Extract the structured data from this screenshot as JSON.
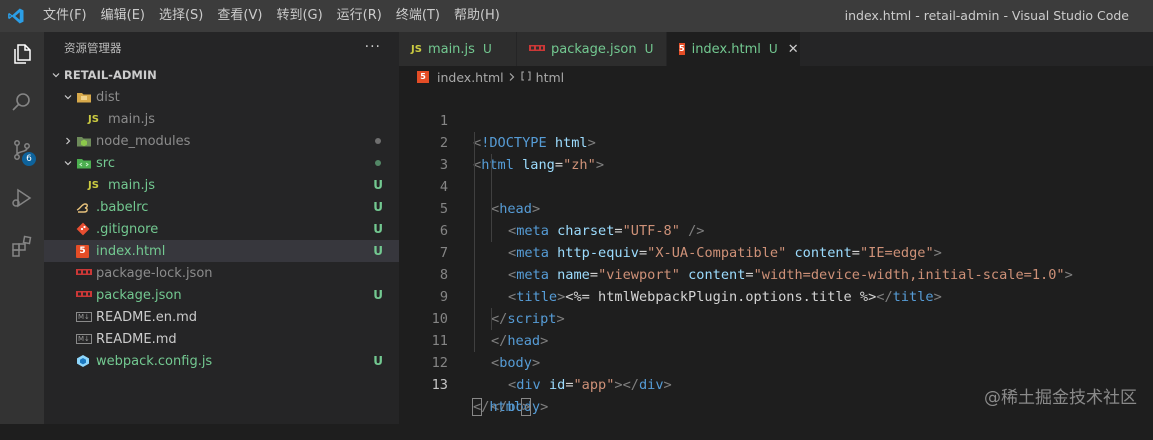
{
  "window": {
    "title": "index.html - retail-admin - Visual Studio Code"
  },
  "menu": [
    "文件(F)",
    "编辑(E)",
    "选择(S)",
    "查看(V)",
    "转到(G)",
    "运行(R)",
    "终端(T)",
    "帮助(H)"
  ],
  "activity": {
    "scm_badge": "6"
  },
  "explorer": {
    "title": "资源管理器",
    "more": "···",
    "project": "RETAIL-ADMIN",
    "items": [
      {
        "name": "dist",
        "status": ""
      },
      {
        "name": "main.js",
        "status": ""
      },
      {
        "name": "node_modules",
        "status": ""
      },
      {
        "name": "src",
        "status": ""
      },
      {
        "name": "main.js",
        "status": "U"
      },
      {
        "name": ".babelrc",
        "status": "U"
      },
      {
        "name": ".gitignore",
        "status": "U"
      },
      {
        "name": "index.html",
        "status": "U"
      },
      {
        "name": "package-lock.json",
        "status": ""
      },
      {
        "name": "package.json",
        "status": "U"
      },
      {
        "name": "README.en.md",
        "status": ""
      },
      {
        "name": "README.md",
        "status": ""
      },
      {
        "name": "webpack.config.js",
        "status": "U"
      }
    ]
  },
  "icons": {
    "js": "JS",
    "html": "5",
    "md": "M↓",
    "json": "{}"
  },
  "tabs": [
    {
      "label": "main.js",
      "status": "U"
    },
    {
      "label": "package.json",
      "status": "U"
    },
    {
      "label": "index.html",
      "status": "U",
      "close": "✕"
    }
  ],
  "breadcrumb": {
    "file": "index.html",
    "symbol": "html"
  },
  "editor": {
    "line_numbers": [
      "1",
      "2",
      "3",
      "4",
      "5",
      "6",
      "7",
      "8",
      "9",
      "10",
      "11",
      "12",
      "13"
    ],
    "code": {
      "doctype": "!DOCTYPE",
      "html": "html",
      "lang_attr": "lang",
      "lang_val": "\"zh\"",
      "head": "head",
      "meta": "meta",
      "charset_attr": "charset",
      "charset_val": "\"UTF-8\"",
      "http_equiv_attr": "http-equiv",
      "http_equiv_val": "\"X-UA-Compatible\"",
      "content_attr": "content",
      "content_val1": "\"IE=edge\"",
      "name_attr": "name",
      "name_val": "\"viewport\"",
      "content_val2": "\"width=device-width,initial-scale=1.0\"",
      "title": "title",
      "title_text": "<%= htmlWebpackPlugin.options.title %>",
      "script": "script",
      "body": "body",
      "div": "div",
      "id_attr": "id",
      "id_val": "\"app\""
    }
  },
  "watermark": "@稀土掘金技术社区",
  "colors": {
    "accent": "#007acc",
    "untracked": "#73c991",
    "tag": "#569cd6",
    "attr": "#9cdcfe",
    "string": "#ce9178"
  }
}
